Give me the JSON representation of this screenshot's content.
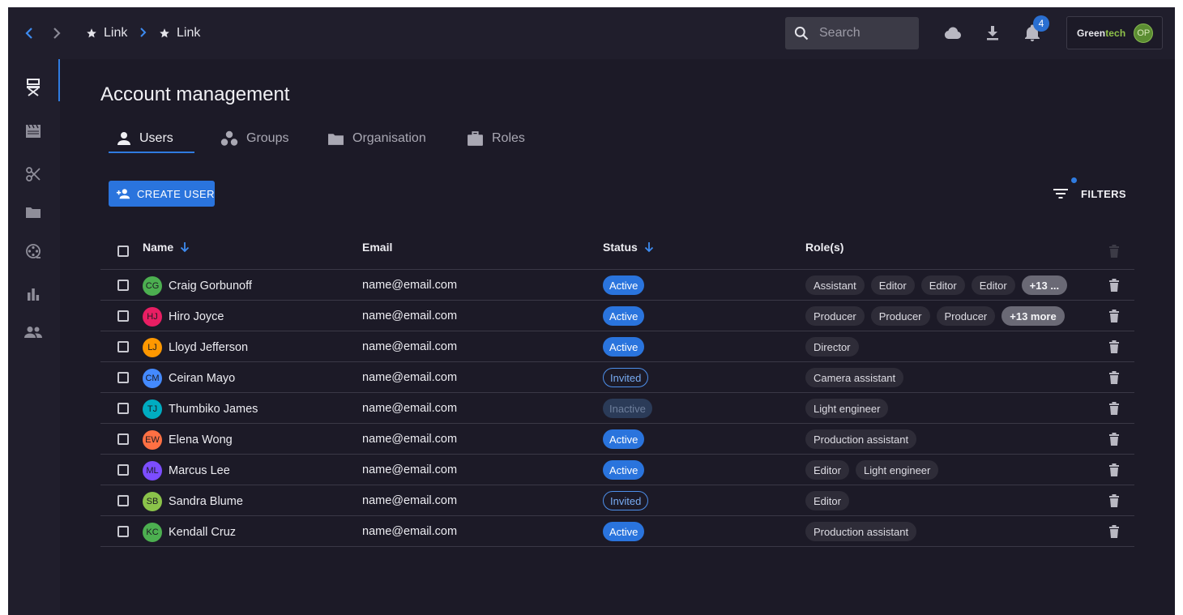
{
  "topbar": {
    "breadcrumb": [
      {
        "label": "Link"
      },
      {
        "label": "Link"
      }
    ],
    "search_placeholder": "Search",
    "notification_count": "4",
    "org": {
      "brand_part1": "Green",
      "brand_part2": "tech",
      "user_initials": "OP"
    }
  },
  "page": {
    "title": "Account management",
    "tabs": [
      {
        "label": "Users",
        "icon": "person-icon"
      },
      {
        "label": "Groups",
        "icon": "groups-icon"
      },
      {
        "label": "Organisation",
        "icon": "folder-icon"
      },
      {
        "label": "Roles",
        "icon": "briefcase-icon"
      }
    ],
    "create_button": "CREATE USER",
    "filters_label": "FILTERS"
  },
  "table": {
    "headers": {
      "name": "Name",
      "email": "Email",
      "status": "Status",
      "roles": "Role(s)"
    },
    "rows": [
      {
        "initials": "CG",
        "avatar_color": "#4caf50",
        "name": "Craig Gorbunoff",
        "email": "name@email.com",
        "status": "Active",
        "status_type": "active",
        "roles": [
          "Assistant",
          "Editor",
          "Editor",
          "Editor"
        ],
        "more": "+13 ..."
      },
      {
        "initials": "HJ",
        "avatar_color": "#e91e63",
        "name": "Hiro Joyce",
        "email": "name@email.com",
        "status": "Active",
        "status_type": "active",
        "roles": [
          "Producer",
          "Producer",
          "Producer"
        ],
        "more": "+13 more"
      },
      {
        "initials": "LJ",
        "avatar_color": "#ff9800",
        "name": "Lloyd Jefferson",
        "email": "name@email.com",
        "status": "Active",
        "status_type": "active",
        "roles": [
          "Director"
        ],
        "more": ""
      },
      {
        "initials": "CM",
        "avatar_color": "#448aff",
        "name": "Ceiran Mayo",
        "email": "name@email.com",
        "status": "Invited",
        "status_type": "invited",
        "roles": [
          "Camera assistant"
        ],
        "more": ""
      },
      {
        "initials": "TJ",
        "avatar_color": "#00acc1",
        "name": "Thumbiko James",
        "email": "name@email.com",
        "status": "Inactive",
        "status_type": "inactive",
        "roles": [
          "Light engineer"
        ],
        "more": ""
      },
      {
        "initials": "EW",
        "avatar_color": "#ff7043",
        "name": "Elena Wong",
        "email": "name@email.com",
        "status": "Active",
        "status_type": "active",
        "roles": [
          "Production assistant"
        ],
        "more": ""
      },
      {
        "initials": "ML",
        "avatar_color": "#7c4dff",
        "name": "Marcus Lee",
        "email": "name@email.com",
        "status": "Active",
        "status_type": "active",
        "roles": [
          "Editor",
          "Light engineer"
        ],
        "more": ""
      },
      {
        "initials": "SB",
        "avatar_color": "#8bc34a",
        "name": "Sandra Blume",
        "email": "name@email.com",
        "status": "Invited",
        "status_type": "invited",
        "roles": [
          "Editor"
        ],
        "more": ""
      },
      {
        "initials": "KC",
        "avatar_color": "#4caf50",
        "name": "Kendall Cruz",
        "email": "name@email.com",
        "status": "Active",
        "status_type": "active",
        "roles": [
          "Production assistant"
        ],
        "more": ""
      }
    ]
  },
  "colors": {
    "accent": "#2a74dd",
    "background": "#1c1a27",
    "surface": "#201e2c"
  },
  "rail_icons": [
    "director-chair-icon",
    "clapperboard-icon",
    "scissors-icon",
    "folder-icon",
    "film-reel-icon",
    "bar-chart-icon",
    "people-icon"
  ]
}
